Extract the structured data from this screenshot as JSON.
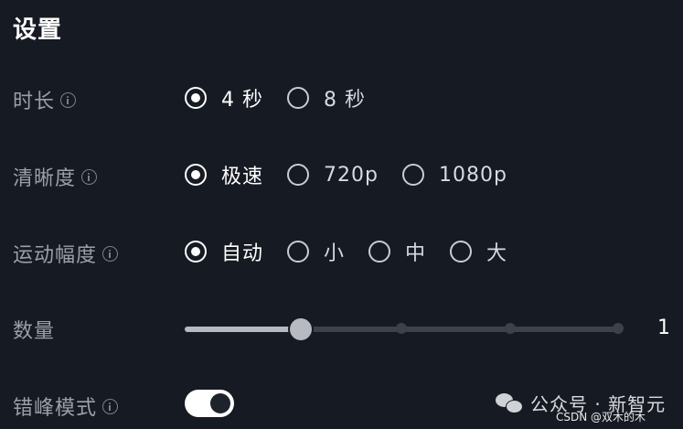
{
  "title": "设置",
  "duration": {
    "label": "时长",
    "options": [
      {
        "label": "4 秒",
        "selected": true
      },
      {
        "label": "8 秒",
        "selected": false
      }
    ]
  },
  "resolution": {
    "label": "清晰度",
    "options": [
      {
        "label": "极速",
        "selected": true
      },
      {
        "label": "720p",
        "selected": false
      },
      {
        "label": "1080p",
        "selected": false
      }
    ]
  },
  "motion": {
    "label": "运动幅度",
    "options": [
      {
        "label": "自动",
        "selected": true
      },
      {
        "label": "小",
        "selected": false
      },
      {
        "label": "中",
        "selected": false
      },
      {
        "label": "大",
        "selected": false
      }
    ]
  },
  "quantity": {
    "label": "数量",
    "value": "1",
    "fraction": 0.267
  },
  "stagger": {
    "label": "错峰模式",
    "enabled": true
  },
  "watermark": {
    "text": "公众号 · 新智元",
    "source": "CSDN @双木的木"
  },
  "colors": {
    "background": "#161a22",
    "accent": "#ffffff"
  }
}
